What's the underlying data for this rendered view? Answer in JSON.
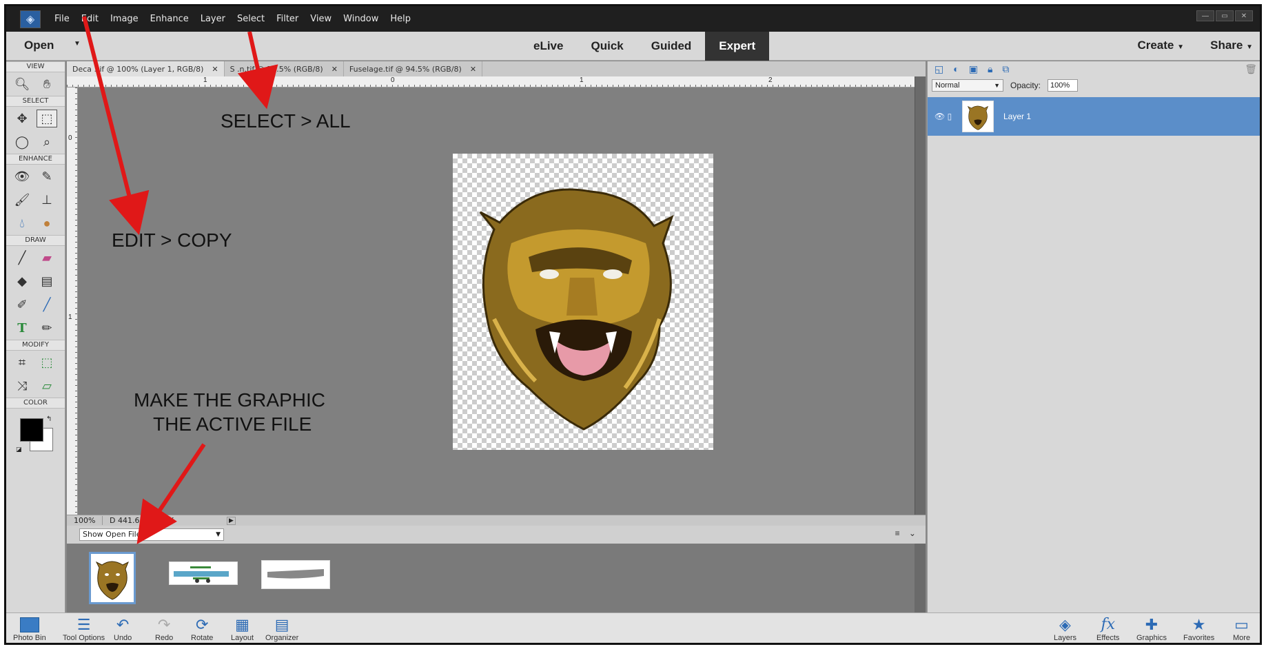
{
  "menubar": {
    "items": [
      "File",
      "Edit",
      "Image",
      "Enhance",
      "Layer",
      "Select",
      "Filter",
      "View",
      "Window",
      "Help"
    ]
  },
  "modebar": {
    "open_label": "Open",
    "tabs": [
      "eLive",
      "Quick",
      "Guided",
      "Expert"
    ],
    "active_tab": "Expert",
    "create_label": "Create",
    "share_label": "Share"
  },
  "toolbox": {
    "sections": [
      "VIEW",
      "SELECT",
      "ENHANCE",
      "DRAW",
      "MODIFY",
      "COLOR"
    ]
  },
  "doc_tabs": [
    {
      "label": "Deca .tif @ 100% (Layer 1, RGB/8)",
      "active": true
    },
    {
      "label": "S  .n.tif @ 58.5% (RGB/8)",
      "active": false
    },
    {
      "label": "Fuselage.tif @ 94.5% (RGB/8)",
      "active": false
    }
  ],
  "rulers": {
    "top": [
      "1",
      "0",
      "1",
      "2"
    ],
    "left": [
      "0",
      "1"
    ]
  },
  "status": {
    "zoom": "100%",
    "doc_size": "D   441.6K/588.8K"
  },
  "photo_bin": {
    "select_value": "Show Open File"
  },
  "layers_panel": {
    "blend_mode": "Normal",
    "opacity_label": "Opacity:",
    "opacity_value": "100%",
    "layer_name": "Layer 1"
  },
  "taskbar": {
    "left": [
      "Photo Bin",
      "Tool Options",
      "Undo",
      "Redo",
      "Rotate",
      "Layout",
      "Organizer"
    ],
    "right": [
      "Layers",
      "Effects",
      "Graphics",
      "Favorites",
      "More"
    ]
  },
  "annotations": {
    "select_all": "SELECT > ALL",
    "edit_copy": "EDIT > COPY",
    "make_active_line1": "MAKE THE GRAPHIC",
    "make_active_line2": "THE ACTIVE FILE"
  },
  "colors": {
    "accent": "#5b8ec9",
    "arrow": "#e01818",
    "menubar": "#1f1f1f"
  }
}
